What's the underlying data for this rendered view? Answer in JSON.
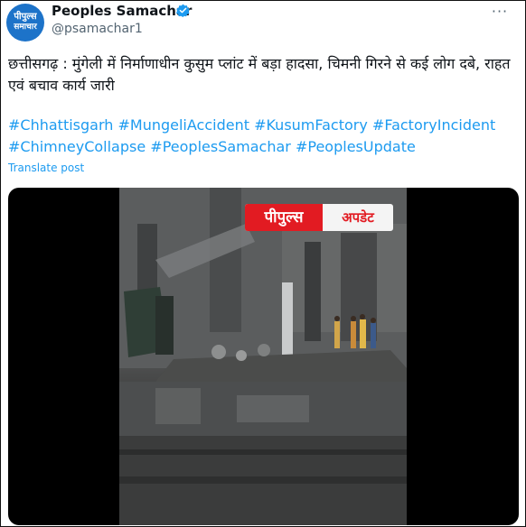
{
  "author": {
    "avatar_line1": "पीपुल्स",
    "avatar_line2": "समाचार",
    "name": "Peoples Samachar",
    "handle": "@psamachar1"
  },
  "more_label": "···",
  "post_text": "छत्तीसगढ़ : मुंगेली में निर्माणाधीन कुसुम प्लांट में बड़ा हादसा, चिमनी गिरने से कई लोग दबे, राहत एवं बचाव कार्य जारी",
  "hashtags": [
    "#Chhattisgarh",
    "#MungeliAccident",
    "#KusumFactory",
    "#FactoryIncident",
    "#ChimneyCollapse",
    "#PeoplesSamachar",
    "#PeoplesUpdate"
  ],
  "translate_label": "Translate post",
  "video": {
    "badge_left": "पीपुल्स",
    "badge_right": "अपडेट"
  },
  "colors": {
    "link": "#1d9bf0",
    "verified": "#1d9bf0",
    "avatar": "#1d73c9",
    "badge_red": "#e21b22"
  }
}
